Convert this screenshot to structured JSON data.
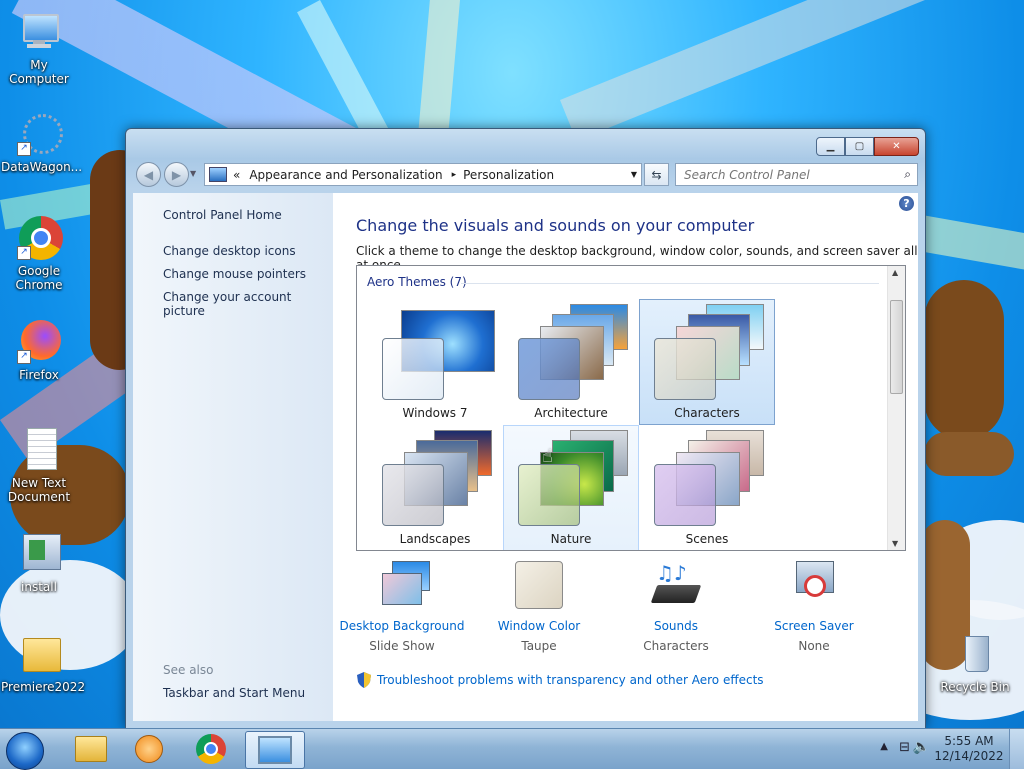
{
  "desktop": {
    "icons": [
      {
        "label": "My Computer"
      },
      {
        "label": "DataWagon..."
      },
      {
        "label": "Google Chrome"
      },
      {
        "label": "Firefox"
      },
      {
        "label": "New Text Document"
      },
      {
        "label": "install"
      },
      {
        "label": "Premiere2022"
      },
      {
        "label": "Recycle Bin"
      }
    ]
  },
  "window": {
    "address": {
      "overflow": "«",
      "crumbs": [
        "Appearance and Personalization",
        "Personalization"
      ],
      "separator": "▸"
    },
    "search_placeholder": "Search Control Panel",
    "left_pane": {
      "home": "Control Panel Home",
      "links": [
        "Change desktop icons",
        "Change mouse pointers",
        "Change your account picture"
      ],
      "see_also_title": "See also",
      "see_also": [
        "Taskbar and Start Menu"
      ]
    },
    "main": {
      "heading": "Change the visuals and sounds on your computer",
      "subtext": "Click a theme to change the desktop background, window color, sounds, and screen saver all at once.",
      "group_header": "Aero Themes (7)",
      "themes": [
        {
          "name": "Windows 7",
          "state": "normal"
        },
        {
          "name": "Architecture",
          "state": "normal"
        },
        {
          "name": "Characters",
          "state": "selected"
        },
        {
          "name": "Landscapes",
          "state": "normal"
        },
        {
          "name": "Nature",
          "state": "hover"
        },
        {
          "name": "Scenes",
          "state": "normal"
        }
      ],
      "bottom_options": [
        {
          "label": "Desktop Background",
          "value": "Slide Show"
        },
        {
          "label": "Window Color",
          "value": "Taupe"
        },
        {
          "label": "Sounds",
          "value": "Characters"
        },
        {
          "label": "Screen Saver",
          "value": "None"
        }
      ],
      "troubleshoot": "Troubleshoot problems with transparency and other Aero effects"
    }
  },
  "taskbar": {
    "time": "5:55 AM",
    "date": "12/14/2022"
  },
  "colors": {
    "link": "#0066cc",
    "heading": "#1e3287",
    "taupe": "#e8e2d4"
  }
}
